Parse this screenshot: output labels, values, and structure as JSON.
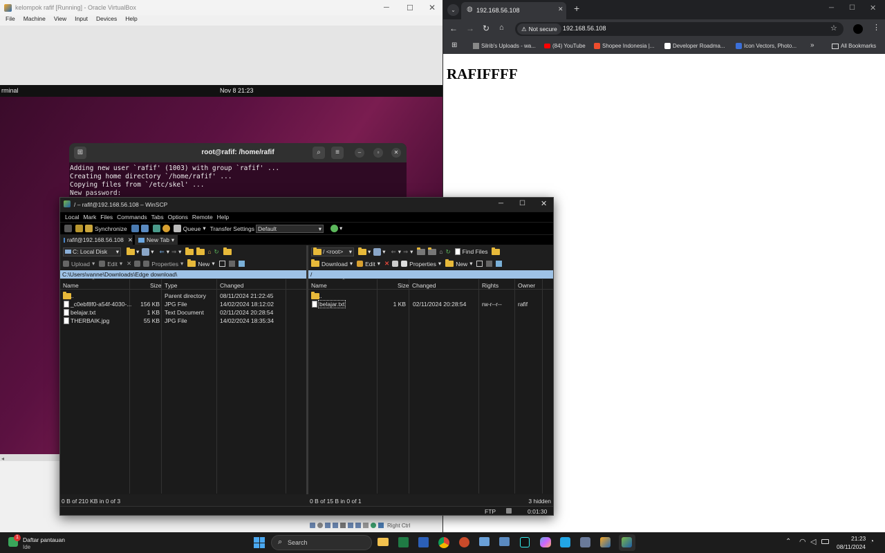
{
  "vbox": {
    "title": "kelompok rafif [Running] - Oracle VirtualBox",
    "menu": [
      "File",
      "Machine",
      "View",
      "Input",
      "Devices",
      "Help"
    ],
    "gnome_left": "rminal",
    "gnome_clock": "Nov 8  21:23",
    "host_key": "Right Ctrl"
  },
  "terminal": {
    "title": "root@rafif: /home/rafif",
    "lines": [
      "Adding new user `rafif' (1003) with group `rafif' ...",
      "Creating home directory `/home/rafif' ...",
      "Copying files from `/etc/skel' ...",
      "New password:"
    ]
  },
  "browser": {
    "tab_title": "192.168.56.108",
    "security": "Not secure",
    "url": "192.168.56.108",
    "bookmarks": [
      "Silrib's Uploads - wa...",
      "(84) YouTube",
      "Shopee Indonesia |...",
      "Developer Roadma...",
      "Icon Vectors, Photo..."
    ],
    "all_bookmarks": "All Bookmarks",
    "page_heading": "RAFIFFFF"
  },
  "winscp": {
    "title": "/ – rafif@192.168.56.108 – WinSCP",
    "menu": [
      "Local",
      "Mark",
      "Files",
      "Commands",
      "Tabs",
      "Options",
      "Remote",
      "Help"
    ],
    "toolbar": {
      "synchronize": "Synchronize",
      "queue": "Queue",
      "transfer_settings": "Transfer Settings",
      "transfer_value": "Default"
    },
    "tabs": [
      "rafif@192.168.56.108",
      "New Tab"
    ],
    "left": {
      "drive": "C: Local Disk",
      "upload": "Upload",
      "edit": "Edit",
      "properties": "Properties",
      "new": "New",
      "path": "C:\\Users\\vanne\\Downloads\\Edge download\\",
      "columns": [
        "Name",
        "Size",
        "Type",
        "Changed"
      ],
      "rows": [
        [
          "..",
          "",
          "Parent directory",
          "08/11/2024 21:22:45"
        ],
        [
          "_c0ebf8f0-a54f-4030-...",
          "156 KB",
          "JPG File",
          "14/02/2024 18:12:02"
        ],
        [
          "belajar.txt",
          "1 KB",
          "Text Document",
          "02/11/2024 20:28:54"
        ],
        [
          "THERBAIK.jpg",
          "55 KB",
          "JPG File",
          "14/02/2024 18:35:34"
        ]
      ],
      "status": "0 B of 210 KB in 0 of 3"
    },
    "right": {
      "drive": "/ <root>",
      "download": "Download",
      "edit": "Edit",
      "properties": "Properties",
      "new": "New",
      "find": "Find Files",
      "path": "/",
      "columns": [
        "Name",
        "Size",
        "Changed",
        "Rights",
        "Owner"
      ],
      "rows": [
        [
          "..",
          "",
          "",
          "",
          ""
        ],
        [
          "belajar.txt",
          "1 KB",
          "02/11/2024 20:28:54",
          "rw-r--r--",
          "rafif"
        ]
      ],
      "status": "0 B of 15 B in 0 of 1",
      "hidden": "3 hidden"
    },
    "protocol": "FTP",
    "time": "0:01:30"
  },
  "taskbar": {
    "weather_title": "Daftar pantauan",
    "weather_sub": "Ide",
    "badge": "1",
    "search": "Search",
    "time": "21:23",
    "date": "08/11/2024"
  },
  "colors": {
    "vbox_bar": "#2d2d2d",
    "ubuntu_purple": "#6f1b4a",
    "winscp_bg": "#1e1e1e",
    "path_bar": "#9ec2e6",
    "taskbar": "#1c1c1c"
  }
}
